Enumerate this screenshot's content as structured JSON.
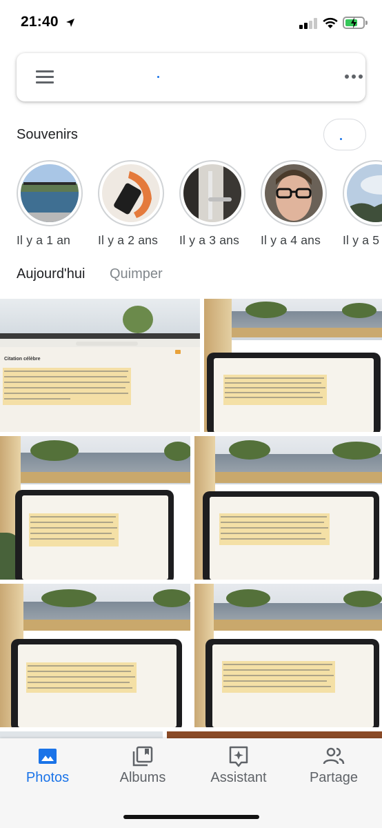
{
  "status_bar": {
    "time": "21:40",
    "icons": [
      "location-arrow-icon",
      "cellular-signal-icon",
      "wifi-icon",
      "battery-charging-icon"
    ]
  },
  "search_bar": {
    "icons": [
      "menu-icon",
      "more-options-icon"
    ]
  },
  "memories": {
    "title": "Souvenirs",
    "items": [
      {
        "label": "Il y a 1 an"
      },
      {
        "label": "Il y a 2 ans"
      },
      {
        "label": "Il y a 3 ans"
      },
      {
        "label": "Il y a 4 ans"
      },
      {
        "label": "Il y a 5"
      }
    ]
  },
  "photos": {
    "date": "Aujourd'hui",
    "location": "Quimper",
    "first_photo_heading": "Citation célèbre"
  },
  "bottom_nav": {
    "items": [
      {
        "label": "Photos",
        "icon": "photos-icon",
        "active": true
      },
      {
        "label": "Albums",
        "icon": "albums-icon",
        "active": false
      },
      {
        "label": "Assistant",
        "icon": "assistant-icon",
        "active": false
      },
      {
        "label": "Partage",
        "icon": "sharing-icon",
        "active": false
      }
    ]
  },
  "colors": {
    "accent": "#1a73e8",
    "inactive": "#5f6368",
    "battery": "#35c759"
  }
}
